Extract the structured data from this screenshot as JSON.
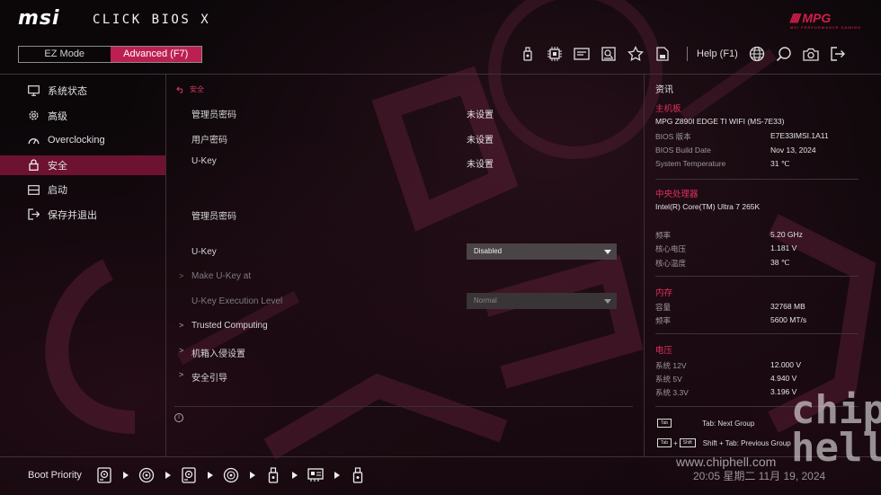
{
  "header": {
    "logo_text": "msi",
    "app_title": "CLICK BIOS X",
    "brand_badge": "MPG",
    "brand_sub": "MSI PERFORMANCE GAMING",
    "modes": [
      {
        "label": "EZ Mode",
        "active": false
      },
      {
        "label": "Advanced (F7)",
        "active": true
      }
    ],
    "help_label": "Help (F1)",
    "toolbar_icons": [
      "usb-flash-icon",
      "cpu-chip-icon",
      "hardware-monitor-icon",
      "board-explorer-icon",
      "favorites-star-icon",
      "save-profile-icon"
    ],
    "right_icons": [
      "language-globe-icon",
      "search-icon",
      "screenshot-camera-icon",
      "exit-icon"
    ]
  },
  "sidebar": {
    "items": [
      {
        "label": "系统状态",
        "icon": "monitor-icon",
        "active": false
      },
      {
        "label": "高级",
        "icon": "gear-icon",
        "active": false
      },
      {
        "label": "Overclocking",
        "icon": "speedometer-icon",
        "active": false
      },
      {
        "label": "安全",
        "icon": "lock-icon",
        "active": true
      },
      {
        "label": "启动",
        "icon": "boot-drive-icon",
        "active": false
      },
      {
        "label": "保存并退出",
        "icon": "exit-icon",
        "active": false
      }
    ]
  },
  "main": {
    "breadcrumb": "安全",
    "rows": [
      {
        "label": "管理员密码",
        "value": "未设置"
      },
      {
        "label": "用户密码",
        "value": "未设置"
      },
      {
        "label": "U-Key",
        "value": "未设置"
      }
    ],
    "admin_password_label": "管理员密码",
    "ukey_label": "U-Key",
    "ukey_select": "Disabled",
    "make_ukey_label": "Make U-Key at",
    "exec_level_label": "U-Key Execution Level",
    "exec_level_select": "Normal",
    "submenus": [
      "Trusted Computing",
      "机箱入侵设置",
      "安全引导"
    ],
    "info_glyph": "i"
  },
  "info_panel": {
    "title": "资讯",
    "motherboard": {
      "heading": "主机板",
      "model": "MPG Z890I EDGE TI WIFI (MS-7E33)",
      "rows": [
        {
          "label": "BIOS 版本",
          "value": "E7E33IMSI.1A11"
        },
        {
          "label": "BIOS Build Date",
          "value": "Nov 13, 2024"
        },
        {
          "label": "System Temperature",
          "value": "31 ℃"
        }
      ]
    },
    "cpu": {
      "heading": "中央处理器",
      "model": "Intel(R) Core(TM) Ultra 7 265K",
      "rows": [
        {
          "label": "频率",
          "value": "5.20 GHz"
        },
        {
          "label": "核心电压",
          "value": "1.181 V"
        },
        {
          "label": "核心温度",
          "value": "38 ℃"
        }
      ]
    },
    "memory": {
      "heading": "内存",
      "rows": [
        {
          "label": "容量",
          "value": "32768 MB"
        },
        {
          "label": "频率",
          "value": "5600 MT/s"
        }
      ]
    },
    "voltage": {
      "heading": "电压",
      "rows": [
        {
          "label": "系统 12V",
          "value": "12.000 V"
        },
        {
          "label": "系统 5V",
          "value": "4.940 V"
        },
        {
          "label": "系统 3.3V",
          "value": "3.196 V"
        }
      ]
    },
    "hints": {
      "tab_key": "Tab",
      "tab_text": "Tab: Next Group",
      "shift_key": "Tab",
      "plus": "+",
      "shift_key2": "Shift",
      "shift_text": "Shift + Tab: Previous Group"
    }
  },
  "bottom": {
    "boot_priority_label": "Boot Priority",
    "devices": [
      "hdd-icon",
      "optical-disc-icon",
      "hdd-icon",
      "optical-disc-icon",
      "usb-flash-icon",
      "network-card-icon",
      "usb-flash-icon"
    ]
  },
  "overlay": {
    "watermark": "www.chiphell.com",
    "datetime": "20:05  星期二 11月 19, 2024",
    "chh_logo": "chip hell"
  },
  "colors": {
    "accent": "#bc2052",
    "accent_text": "#e0305e",
    "active_sidebar": "#6e1232",
    "background": "#0b0709"
  }
}
